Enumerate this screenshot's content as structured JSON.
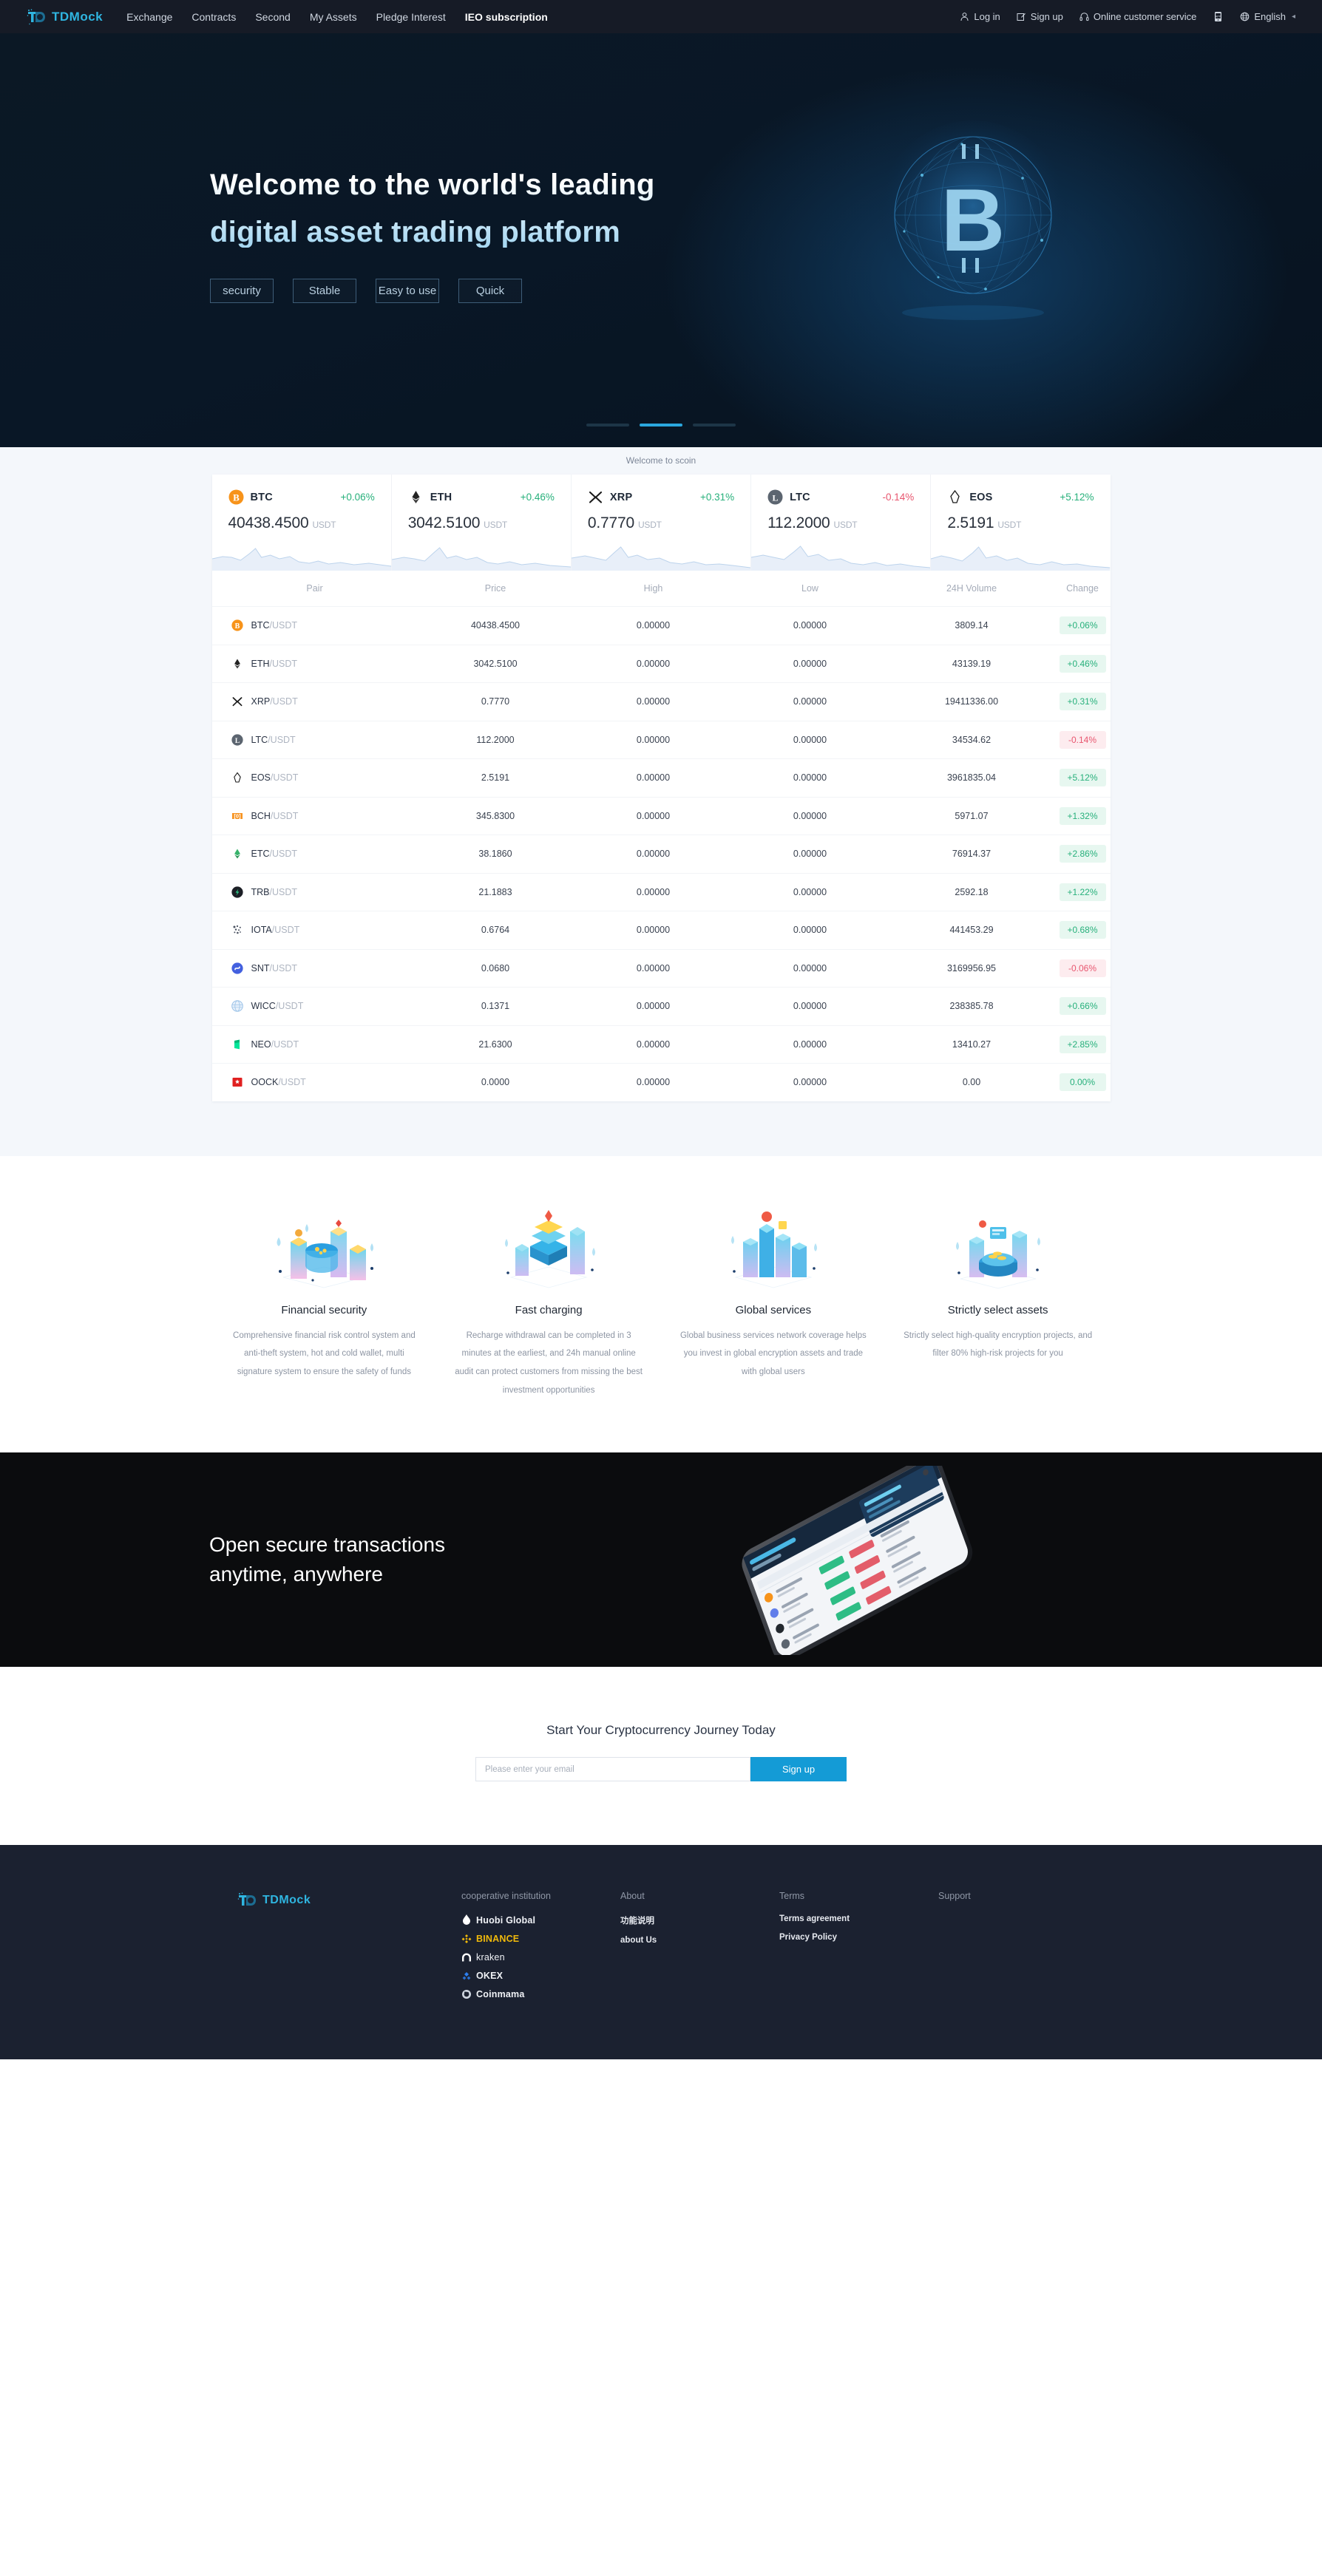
{
  "header": {
    "logo_text": "TDMock",
    "nav": [
      {
        "label": "Exchange",
        "active": false
      },
      {
        "label": "Contracts",
        "active": false
      },
      {
        "label": "Second",
        "active": false
      },
      {
        "label": "My Assets",
        "active": false
      },
      {
        "label": "Pledge Interest",
        "active": false
      },
      {
        "label": "IEO subscription",
        "active": true
      }
    ],
    "login": "Log in",
    "signup": "Sign up",
    "support": "Online customer service",
    "language": "English"
  },
  "hero": {
    "title_line1": "Welcome to the world's leading",
    "title_line2": "digital asset trading platform",
    "tags": [
      "security",
      "Stable",
      "Easy to use",
      "Quick"
    ],
    "carousel_active_index": 1,
    "carousel_count": 3
  },
  "welcome_strip": {
    "text": "Welcome to scoin"
  },
  "tickers": [
    {
      "symbol": "BTC",
      "change": "+0.06%",
      "dir": "up",
      "price": "40438.4500",
      "unit": "USDT",
      "icon": "btc-icon"
    },
    {
      "symbol": "ETH",
      "change": "+0.46%",
      "dir": "up",
      "price": "3042.5100",
      "unit": "USDT",
      "icon": "eth-icon"
    },
    {
      "symbol": "XRP",
      "change": "+0.31%",
      "dir": "up",
      "price": "0.7770",
      "unit": "USDT",
      "icon": "xrp-icon"
    },
    {
      "symbol": "LTC",
      "change": "-0.14%",
      "dir": "down",
      "price": "112.2000",
      "unit": "USDT",
      "icon": "ltc-icon"
    },
    {
      "symbol": "EOS",
      "change": "+5.12%",
      "dir": "up",
      "price": "2.5191",
      "unit": "USDT",
      "icon": "eos-icon"
    }
  ],
  "market_table": {
    "columns": [
      "Pair",
      "Price",
      "High",
      "Low",
      "24H Volume",
      "Change"
    ],
    "rows": [
      {
        "base": "BTC",
        "quote": "/USDT",
        "price": "40438.4500",
        "price_dir": "up",
        "high": "0.00000",
        "low": "0.00000",
        "volume": "3809.14",
        "change": "+0.06%",
        "dir": "up",
        "icon": "btc-icon"
      },
      {
        "base": "ETH",
        "quote": "/USDT",
        "price": "3042.5100",
        "price_dir": "up",
        "high": "0.00000",
        "low": "0.00000",
        "volume": "43139.19",
        "change": "+0.46%",
        "dir": "up",
        "icon": "eth-icon"
      },
      {
        "base": "XRP",
        "quote": "/USDT",
        "price": "0.7770",
        "price_dir": "up",
        "high": "0.00000",
        "low": "0.00000",
        "volume": "19411336.00",
        "change": "+0.31%",
        "dir": "up",
        "icon": "xrp-icon"
      },
      {
        "base": "LTC",
        "quote": "/USDT",
        "price": "112.2000",
        "price_dir": "down",
        "high": "0.00000",
        "low": "0.00000",
        "volume": "34534.62",
        "change": "-0.14%",
        "dir": "down",
        "icon": "ltc-icon"
      },
      {
        "base": "EOS",
        "quote": "/USDT",
        "price": "2.5191",
        "price_dir": "up",
        "high": "0.00000",
        "low": "0.00000",
        "volume": "3961835.04",
        "change": "+5.12%",
        "dir": "up",
        "icon": "eos-icon"
      },
      {
        "base": "BCH",
        "quote": "/USDT",
        "price": "345.8300",
        "price_dir": "up",
        "high": "0.00000",
        "low": "0.00000",
        "volume": "5971.07",
        "change": "+1.32%",
        "dir": "up",
        "icon": "bch-icon"
      },
      {
        "base": "ETC",
        "quote": "/USDT",
        "price": "38.1860",
        "price_dir": "up",
        "high": "0.00000",
        "low": "0.00000",
        "volume": "76914.37",
        "change": "+2.86%",
        "dir": "up",
        "icon": "etc-icon"
      },
      {
        "base": "TRB",
        "quote": "/USDT",
        "price": "21.1883",
        "price_dir": "up",
        "high": "0.00000",
        "low": "0.00000",
        "volume": "2592.18",
        "change": "+1.22%",
        "dir": "up",
        "icon": "trb-icon"
      },
      {
        "base": "IOTA",
        "quote": "/USDT",
        "price": "0.6764",
        "price_dir": "up",
        "high": "0.00000",
        "low": "0.00000",
        "volume": "441453.29",
        "change": "+0.68%",
        "dir": "up",
        "icon": "iota-icon"
      },
      {
        "base": "SNT",
        "quote": "/USDT",
        "price": "0.0680",
        "price_dir": "down",
        "high": "0.00000",
        "low": "0.00000",
        "volume": "3169956.95",
        "change": "-0.06%",
        "dir": "down",
        "icon": "snt-icon"
      },
      {
        "base": "WICC",
        "quote": "/USDT",
        "price": "0.1371",
        "price_dir": "up",
        "high": "0.00000",
        "low": "0.00000",
        "volume": "238385.78",
        "change": "+0.66%",
        "dir": "up",
        "icon": "wicc-icon"
      },
      {
        "base": "NEO",
        "quote": "/USDT",
        "price": "21.6300",
        "price_dir": "up",
        "high": "0.00000",
        "low": "0.00000",
        "volume": "13410.27",
        "change": "+2.85%",
        "dir": "up",
        "icon": "neo-icon"
      },
      {
        "base": "OOCK",
        "quote": "/USDT",
        "price": "0.0000",
        "price_dir": "up",
        "high": "0.00000",
        "low": "0.00000",
        "volume": "0.00",
        "change": "0.00%",
        "dir": "up",
        "icon": "oock-icon"
      }
    ]
  },
  "features": [
    {
      "title": "Financial security",
      "desc": "Comprehensive financial risk control system and anti-theft system, hot and cold wallet, multi signature system to ensure the safety of funds"
    },
    {
      "title": "Fast charging",
      "desc": "Recharge withdrawal can be completed in 3 minutes at the earliest, and 24h manual online audit can protect customers from missing the best investment opportunities"
    },
    {
      "title": "Global services",
      "desc": "Global business services network coverage helps you invest in global encryption assets and trade with global users"
    },
    {
      "title": "Strictly select assets",
      "desc": "Strictly select high-quality encryption projects, and filter 80% high-risk projects for you"
    }
  ],
  "app_banner": {
    "line1": "Open secure transactions",
    "line2": "anytime, anywhere"
  },
  "newsletter": {
    "heading": "Start Your Cryptocurrency Journey Today",
    "placeholder": "Please enter your email",
    "button": "Sign up"
  },
  "footer": {
    "logo_text": "TDMock",
    "cooperative_title": "cooperative institution",
    "partners": [
      {
        "name": "Huobi Global",
        "icon": "huobi-icon"
      },
      {
        "name": "BINANCE",
        "icon": "binance-icon"
      },
      {
        "name": "kraken",
        "icon": "kraken-icon"
      },
      {
        "name": "OKEX",
        "icon": "okex-icon"
      },
      {
        "name": "Coinmama",
        "icon": "coinmama-icon"
      }
    ],
    "columns": [
      {
        "title": "About",
        "links": [
          "功能说明",
          "about Us"
        ]
      },
      {
        "title": "Terms",
        "links": [
          "Terms agreement",
          "Privacy Policy"
        ]
      },
      {
        "title": "Support",
        "links": []
      }
    ]
  },
  "colors": {
    "accent": "#149bd6",
    "brand": "#2fb5e0",
    "up": "#27b07b",
    "down": "#e8566f",
    "nav_bg": "#161b26",
    "footer_bg": "#1b2130"
  }
}
